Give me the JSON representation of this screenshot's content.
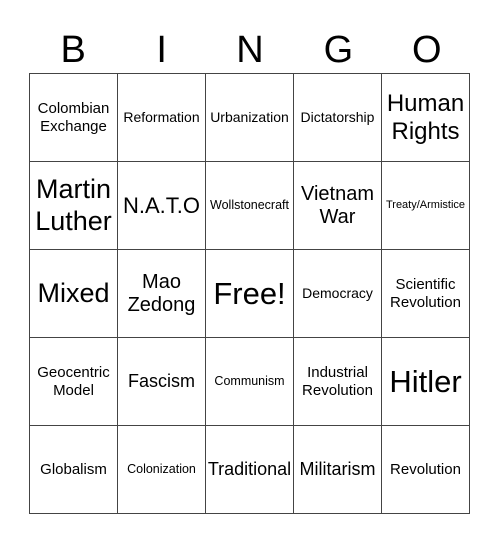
{
  "header": {
    "letters": [
      "B",
      "I",
      "N",
      "G",
      "O"
    ]
  },
  "board": {
    "rows": [
      [
        "Colombian Exchange",
        "Reformation",
        "Urbanization",
        "Dictatorship",
        "Human Rights"
      ],
      [
        "Martin Luther",
        "N.A.T.O",
        "Wollstonecraft",
        "Vietnam War",
        "Treaty/Armistice"
      ],
      [
        "Mixed",
        "Mao Zedong",
        "Free!",
        "Democracy",
        "Scientific Revolution"
      ],
      [
        "Geocentric Model",
        "Fascism",
        "Communism",
        "Industrial Revolution",
        "Hitler"
      ],
      [
        "Globalism",
        "Colonization",
        "Traditional",
        "Militarism",
        "Revolution"
      ]
    ]
  }
}
